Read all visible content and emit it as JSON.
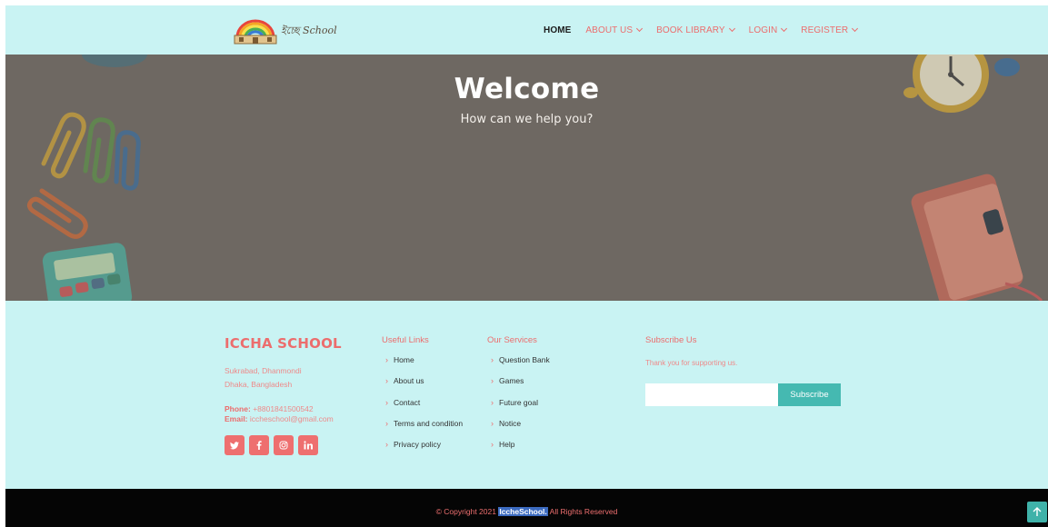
{
  "header": {
    "logo_text": "ইচ্ছে School",
    "nav": [
      {
        "label": "HOME",
        "active": true
      },
      {
        "label": "ABOUT US"
      },
      {
        "label": "BOOK LIBRARY"
      },
      {
        "label": "LOGIN"
      },
      {
        "label": "REGISTER"
      }
    ]
  },
  "hero": {
    "title": "Welcome",
    "subtitle": "How can we help you?"
  },
  "footer": {
    "brand": "ICCHA SCHOOL",
    "address_line1": "Sukrabad, Dhanmondi",
    "address_line2": "Dhaka, Bangladesh",
    "phone_label": "Phone:",
    "phone": "+8801841500542",
    "email_label": "Email:",
    "email": "iccheschool@gmail.com",
    "socials": [
      "twitter-icon",
      "facebook-icon",
      "instagram-icon",
      "linkedin-icon"
    ],
    "useful_links": {
      "title": "Useful Links",
      "items": [
        "Home",
        "About us",
        "Contact",
        "Terms and condition",
        "Privacy policy"
      ]
    },
    "services": {
      "title": "Our Services",
      "items": [
        "Question Bank",
        "Games",
        "Future goal",
        "Notice",
        "Help"
      ]
    },
    "subscribe": {
      "title": "Subscribe Us",
      "text": "Thank you for supporting us.",
      "input_placeholder": "",
      "button": "Subscribe"
    }
  },
  "copyright": {
    "prefix": "© Copyright 2021",
    "highlight": "IccheSchool.",
    "suffix": "All Rights Reserved"
  },
  "colors": {
    "accent": "#ec6d6d",
    "background": "#c9f3f3",
    "button": "#45b9b1"
  }
}
